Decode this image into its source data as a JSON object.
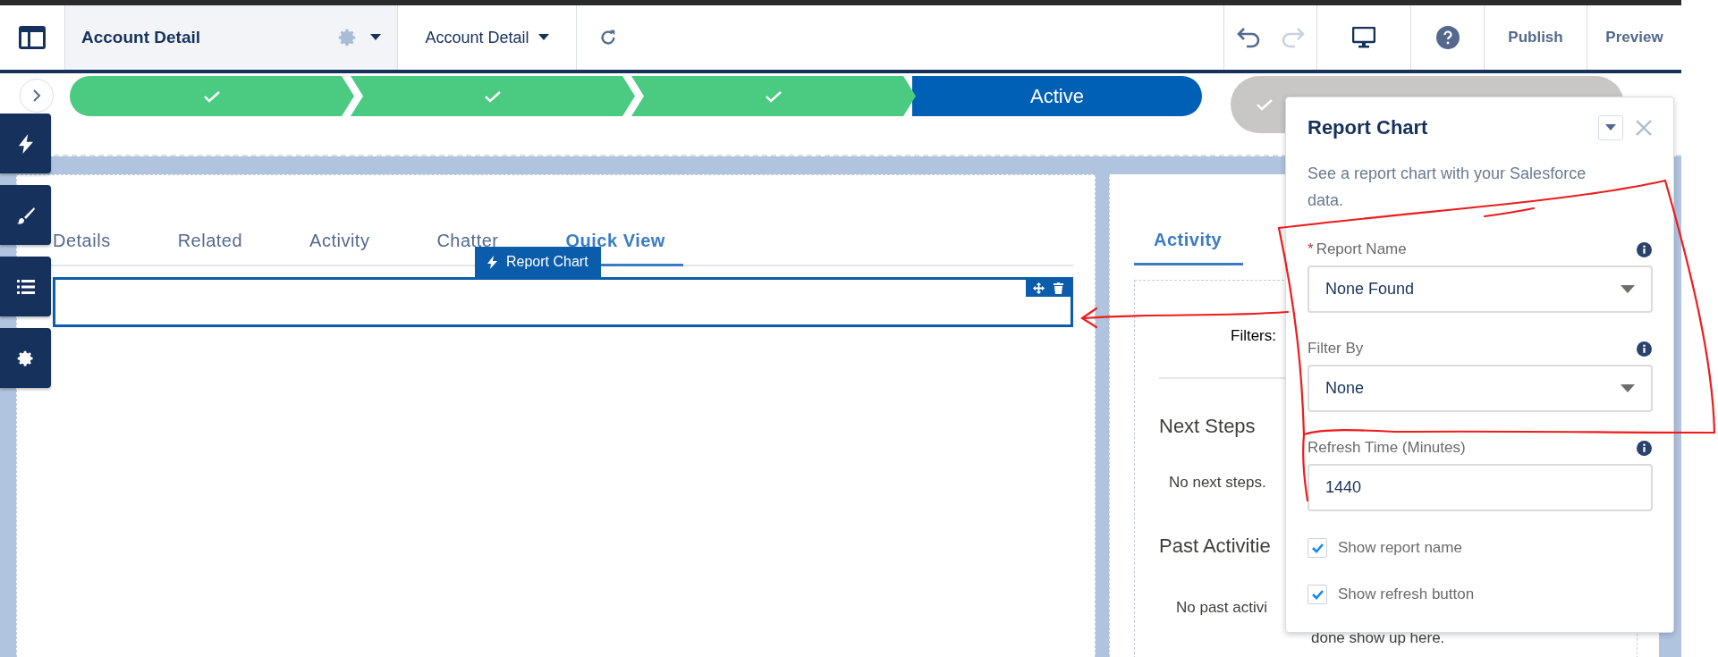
{
  "header": {
    "page_name": "Account Detail",
    "breadcrumb": "Account Detail",
    "history": [
      {
        "kind": "undo",
        "disabled": false
      },
      {
        "kind": "redo",
        "disabled": true
      }
    ],
    "actions": [
      {
        "label": "Publish"
      },
      {
        "label": "Preview"
      }
    ]
  },
  "path": {
    "stages": [
      {
        "kind": "complete"
      },
      {
        "kind": "complete"
      },
      {
        "kind": "complete"
      },
      {
        "kind": "current",
        "label": "Active"
      },
      {
        "kind": "closed"
      }
    ]
  },
  "left_tabs": [
    {
      "label": "Details",
      "selected": false
    },
    {
      "label": "Related",
      "selected": false
    },
    {
      "label": "Activity",
      "selected": false
    },
    {
      "label": "Chatter",
      "selected": false
    },
    {
      "label": "Quick View",
      "selected": true
    }
  ],
  "selected_component": {
    "label": "Report Chart"
  },
  "right_panel": {
    "tabs": [
      {
        "label": "Activity",
        "selected": true
      }
    ],
    "filters_label": "Filters:",
    "sections": [
      {
        "title": "Next Steps",
        "lines": [
          "No next steps."
        ]
      },
      {
        "title": "Past Activitie",
        "lines": [
          "No past activi",
          "done show up here."
        ]
      }
    ]
  },
  "properties_panel": {
    "title": "Report Chart",
    "description": "See a report chart with your Salesforce data.",
    "fields": [
      {
        "kind": "select",
        "label": "Report Name",
        "required_mark": "*",
        "value": "None Found"
      },
      {
        "kind": "select",
        "label": "Filter By",
        "value": "None"
      },
      {
        "kind": "input",
        "label": "Refresh Time (Minutes)",
        "value": "1440"
      }
    ],
    "options": [
      {
        "label": "Show report name",
        "checked": true
      },
      {
        "label": "Show refresh button",
        "checked": true
      }
    ]
  }
}
